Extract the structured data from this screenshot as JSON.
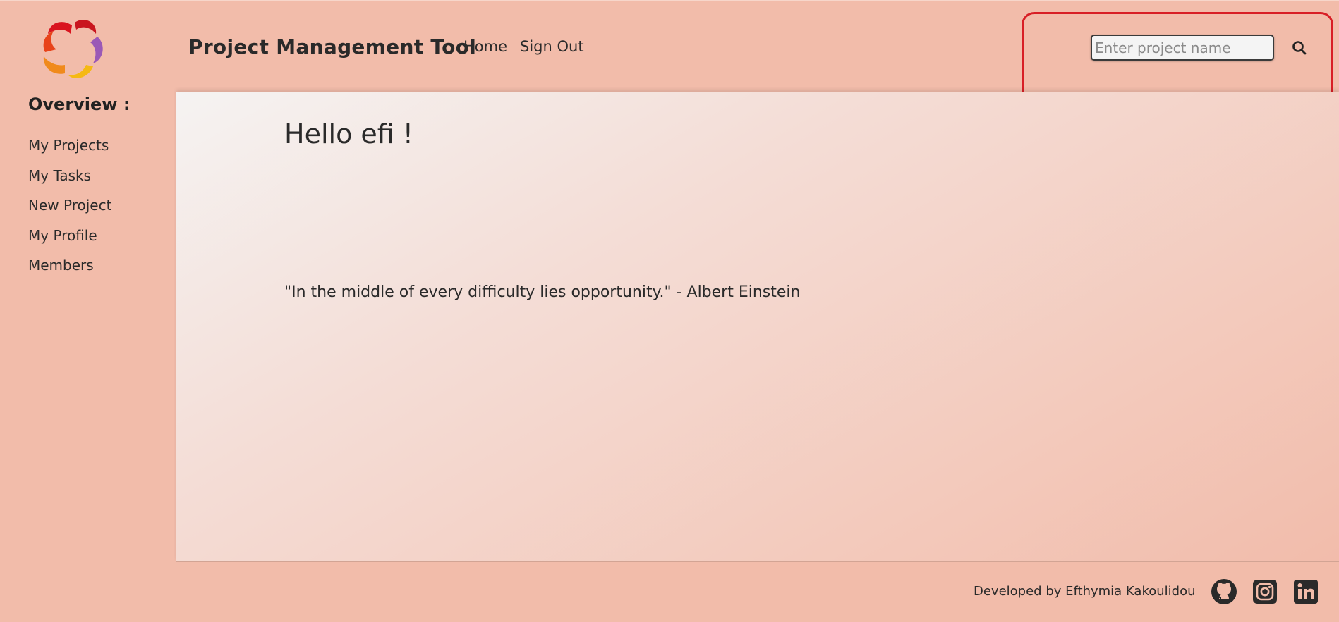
{
  "app": {
    "title": "Project Management Tool"
  },
  "header": {
    "nav": [
      {
        "label": "Home"
      },
      {
        "label": "Sign Out"
      }
    ],
    "search": {
      "placeholder": "Enter project name",
      "value": "",
      "button_icon": "search-icon"
    },
    "highlight_color": "#d81f26"
  },
  "sidebar": {
    "heading": "Overview :",
    "items": [
      {
        "label": "My Projects"
      },
      {
        "label": "My Tasks"
      },
      {
        "label": "New Project"
      },
      {
        "label": "My Profile"
      },
      {
        "label": "Members"
      }
    ]
  },
  "main": {
    "greeting": "Hello efi !",
    "quote": "\"In the middle of every difficulty lies opportunity.\" - Albert Einstein"
  },
  "footer": {
    "credit": "Developed by Efthymia Kakoulidou",
    "social_icons": [
      "github-icon",
      "instagram-icon",
      "linkedin-icon"
    ]
  },
  "theme": {
    "background": "#f2bcaa",
    "text": "#2a2a2a"
  }
}
